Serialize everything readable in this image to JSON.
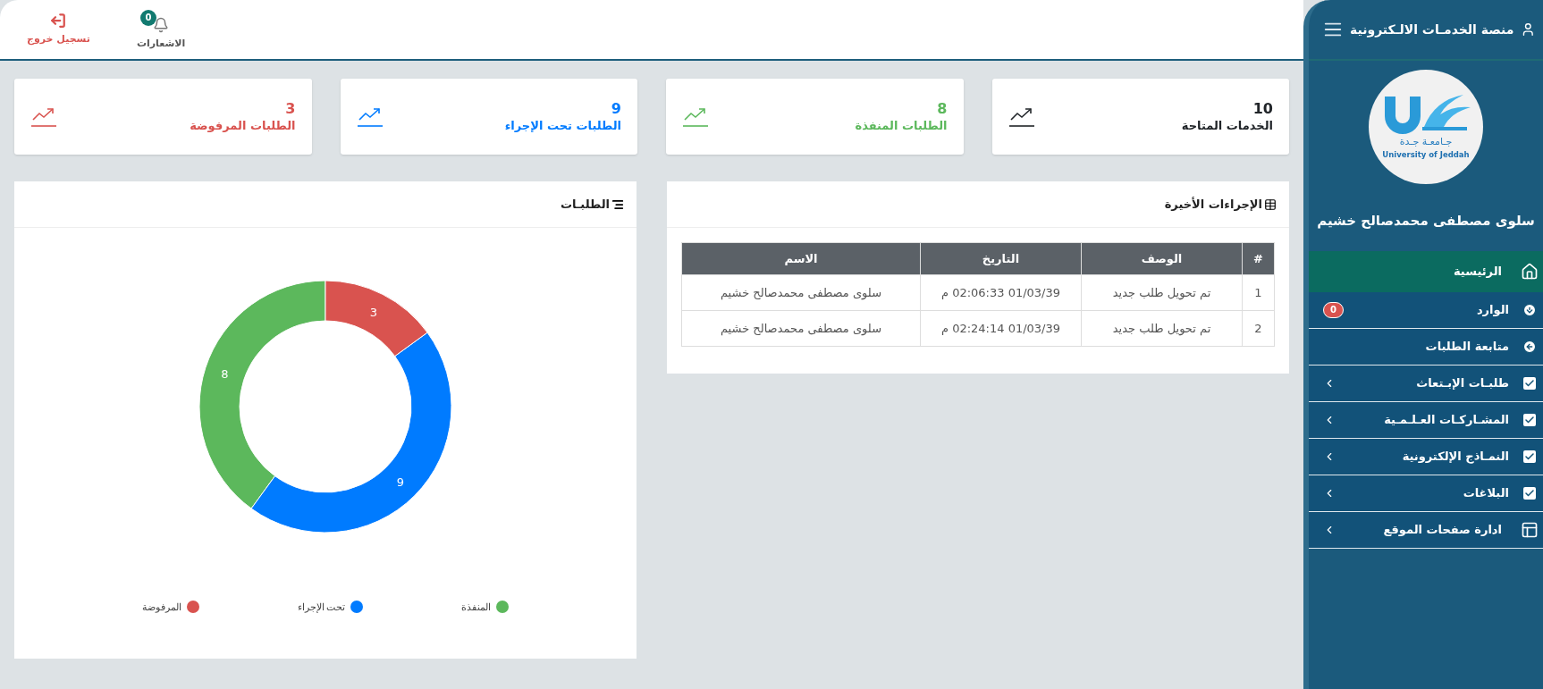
{
  "sidebar": {
    "title": "منصة الخدمـات الالـكترونية",
    "logo": {
      "arabic": "جـامعـة جـدة",
      "english": "University of Jeddah"
    },
    "user_name": "سلوى مصطفى محمدصالح خشيم",
    "menu": [
      {
        "label": "الرئيسية",
        "selected": true,
        "expandable": false
      },
      {
        "label": "الوارد",
        "selected": false,
        "expandable": false,
        "badge": "0"
      },
      {
        "label": "متابعة الطلبات",
        "selected": false,
        "expandable": false
      },
      {
        "label": "طلبـات الإبـتعاث",
        "selected": false,
        "expandable": true
      },
      {
        "label": "المشـاركـات العـلـمـية",
        "selected": false,
        "expandable": true
      },
      {
        "label": "النمـاذج الإلكترونية",
        "selected": false,
        "expandable": true
      },
      {
        "label": "البلاغات",
        "selected": false,
        "expandable": true
      },
      {
        "label": "ادارة صفحات الموقع",
        "selected": false,
        "expandable": true
      }
    ]
  },
  "topbar": {
    "notifications": {
      "label": "الاشعارات",
      "count": "0"
    },
    "logout": {
      "label": "تسجيل خروج"
    }
  },
  "stats": [
    {
      "value": "10",
      "label": "الخدمات المتاحة",
      "color": "#212529"
    },
    {
      "value": "8",
      "label": "الطلبات المنفذة",
      "color": "#5cb85c"
    },
    {
      "value": "9",
      "label": "الطلبات تحت الإجراء",
      "color": "#007bff"
    },
    {
      "value": "3",
      "label": "الطلبات المرفوضة",
      "color": "#d9534f"
    }
  ],
  "recent_actions": {
    "title": "الإجراءات الأخيرة",
    "columns": [
      "#",
      "الوصف",
      "التاريخ",
      "الاسم"
    ],
    "rows": [
      [
        "1",
        "تم تحويل طلب جديد",
        "01/03/39 02:06:33 م",
        "سلوى مصطفى محمدصالح خشيم"
      ],
      [
        "2",
        "تم تحويل طلب جديد",
        "01/03/39 02:24:14 م",
        "سلوى مصطفى محمدصالح خشيم"
      ]
    ]
  },
  "requests_chart": {
    "title": "الطلبـات",
    "chart_data": {
      "type": "donut",
      "categories": [
        "المنفذة",
        "تحت الإجراء",
        "المرفوضة"
      ],
      "values": [
        8,
        9,
        3
      ],
      "colors": [
        "#5cb85c",
        "#007bff",
        "#d9534f"
      ],
      "data_labels": true
    }
  }
}
